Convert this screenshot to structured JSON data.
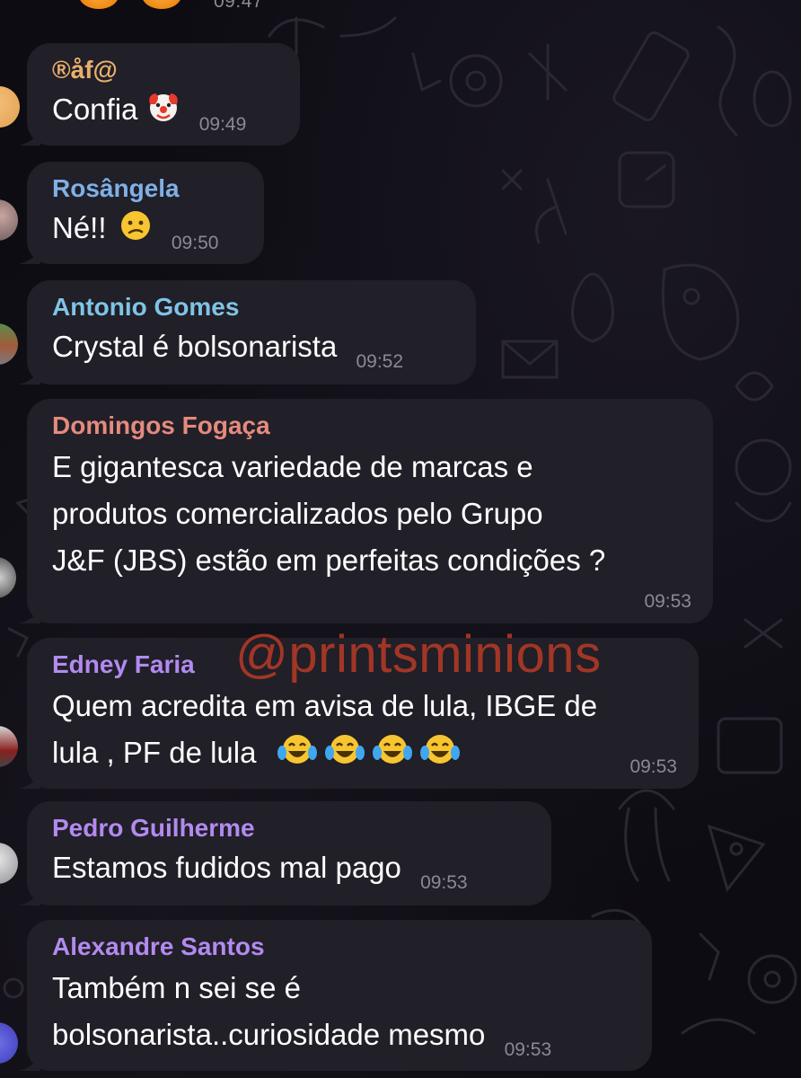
{
  "top": {
    "time": "09:47"
  },
  "messages": [
    {
      "sender": "®åf@",
      "sender_color": "#e8b06e",
      "text": "Confia",
      "emoji": "clown-face",
      "time": "09:49"
    },
    {
      "sender": "Rosângela",
      "sender_color": "#7fb0e6",
      "text": "Né!!",
      "emoji": "confused-face",
      "time": "09:50"
    },
    {
      "sender": "Antonio Gomes",
      "sender_color": "#7fc4e6",
      "text": "Crystal é bolsonarista",
      "time": "09:52"
    },
    {
      "sender": "Domingos Fogaça",
      "sender_color": "#e58a7e",
      "lines": [
        "E gigantesca variedade de marcas e",
        "produtos comercializados pelo Grupo",
        "J&F (JBS) estão em perfeitas condições ?"
      ],
      "time": "09:53"
    },
    {
      "sender": "Edney Faria",
      "sender_color": "#b28af0",
      "lines": [
        "Quem acredita em avisa de lula, IBGE de",
        "lula , PF de lula"
      ],
      "emoji": "tears-of-joy x4",
      "time": "09:53"
    },
    {
      "sender": "Pedro Guilherme",
      "sender_color": "#b28af0",
      "text": "Estamos fudidos mal pago",
      "time": "09:53"
    },
    {
      "sender": "Alexandre Santos",
      "sender_color": "#b28af0",
      "lines": [
        "Também n sei se é",
        "bolsonarista..curiosidade mesmo"
      ],
      "time": "09:53"
    }
  ],
  "watermark": "@printsminions",
  "bubble_color": "#211f27",
  "background_color": "#0d0c12"
}
